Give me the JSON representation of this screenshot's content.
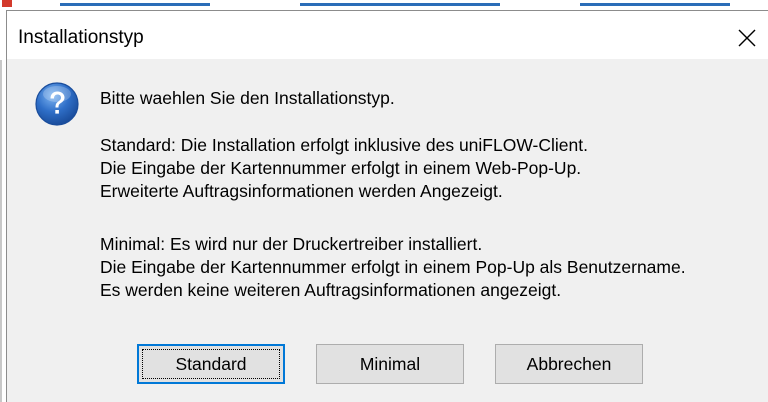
{
  "window": {
    "title": "Installationstyp",
    "close_icon": "close-icon"
  },
  "message": {
    "icon": "question-icon",
    "prompt": "Bitte waehlen Sie den Installationstyp.",
    "standard_lines": [
      "Standard: Die Installation erfolgt inklusive des uniFLOW-Client.",
      "Die Eingabe der Kartennummer erfolgt in einem Web-Pop-Up.",
      "Erweiterte Auftragsinformationen werden Angezeigt."
    ],
    "minimal_lines": [
      "Minimal: Es wird nur der Druckertreiber installiert.",
      "Die Eingabe der Kartennummer erfolgt in einem Pop-Up als Benutzername.",
      "Es werden keine weiteren Auftragsinformationen angezeigt."
    ]
  },
  "buttons": {
    "standard": "Standard",
    "minimal": "Minimal",
    "cancel": "Abbrechen"
  },
  "colors": {
    "accent": "#0078d7",
    "client_bg": "#f0f0f0",
    "button_bg": "#e1e1e1",
    "icon_blue": "#2f6fc8"
  }
}
